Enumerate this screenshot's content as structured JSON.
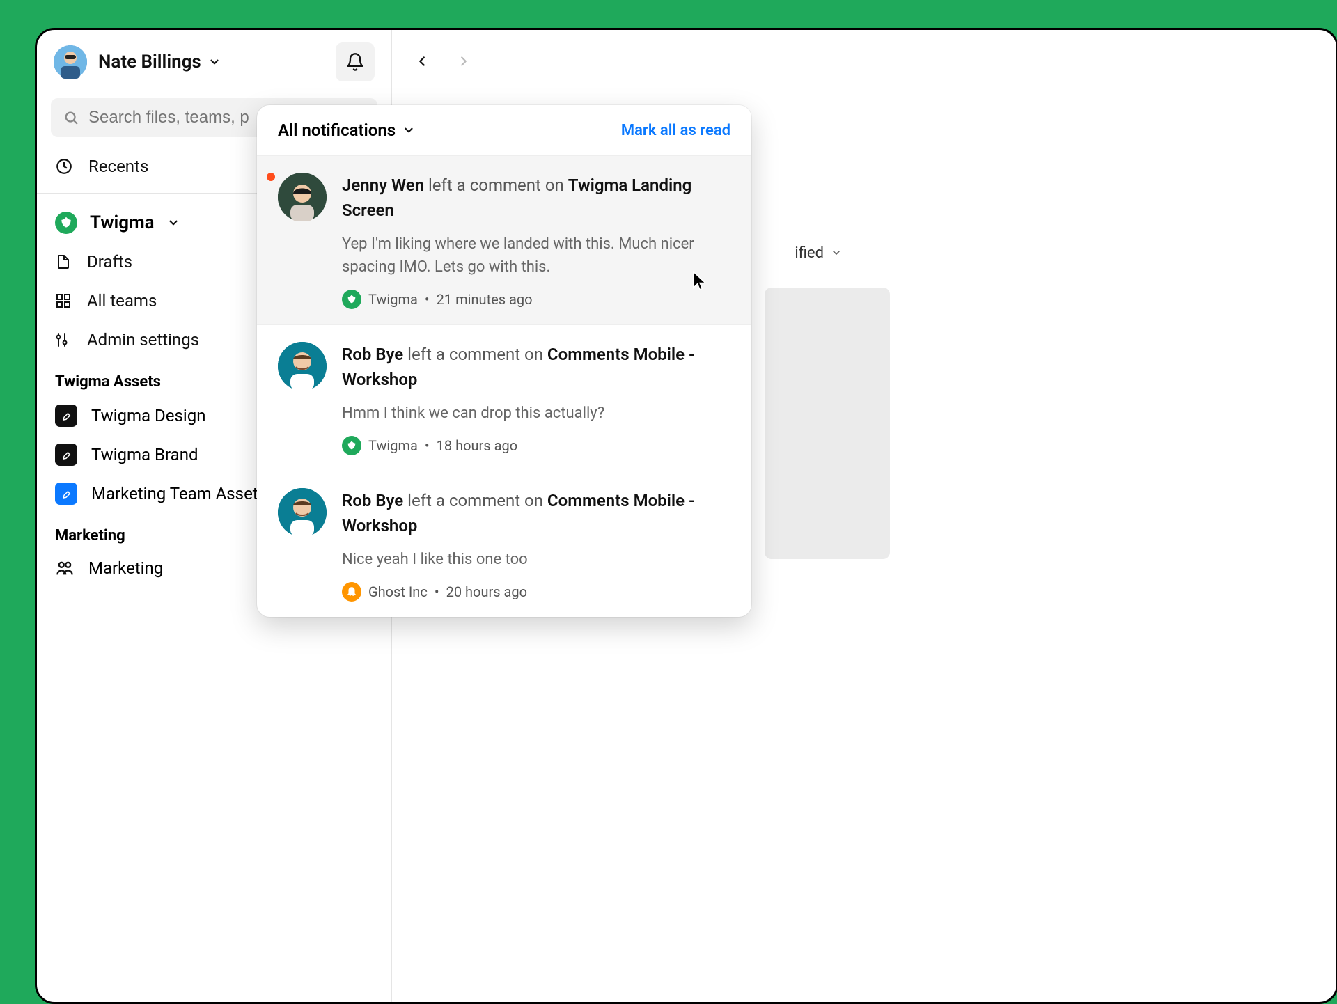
{
  "user": {
    "name": "Nate Billings"
  },
  "search": {
    "placeholder": "Search files, teams, p"
  },
  "sidebar": {
    "recents": "Recents",
    "team": {
      "name": "Twigma"
    },
    "drafts": "Drafts",
    "all_teams": "All teams",
    "admin": "Admin settings",
    "section1": "Twigma Assets",
    "proj1": "Twigma Design",
    "proj2": "Twigma Brand",
    "proj3": "Marketing Team Assets",
    "section2": "Marketing",
    "proj4": "Marketing"
  },
  "content": {
    "sort_label": "ified"
  },
  "notifications": {
    "header": "All notifications",
    "mark_all": "Mark all as read",
    "items": [
      {
        "actor": "Jenny Wen",
        "verb": " left a comment on ",
        "target": "Twigma Landing Screen",
        "comment": "Yep I'm liking where we landed with this. Much nicer spacing IMO. Lets go with this.",
        "workspace": "Twigma",
        "time": "21 minutes ago"
      },
      {
        "actor": "Rob Bye",
        "verb": " left a comment on ",
        "target": "Comments Mobile - Workshop",
        "comment": "Hmm I think we can drop this actually?",
        "workspace": "Twigma",
        "time": "18 hours ago"
      },
      {
        "actor": "Rob Bye",
        "verb": " left a comment on ",
        "target": "Comments Mobile - Workshop",
        "comment": "Nice yeah I like this one too",
        "workspace": "Ghost Inc",
        "time": "20 hours ago"
      }
    ]
  }
}
